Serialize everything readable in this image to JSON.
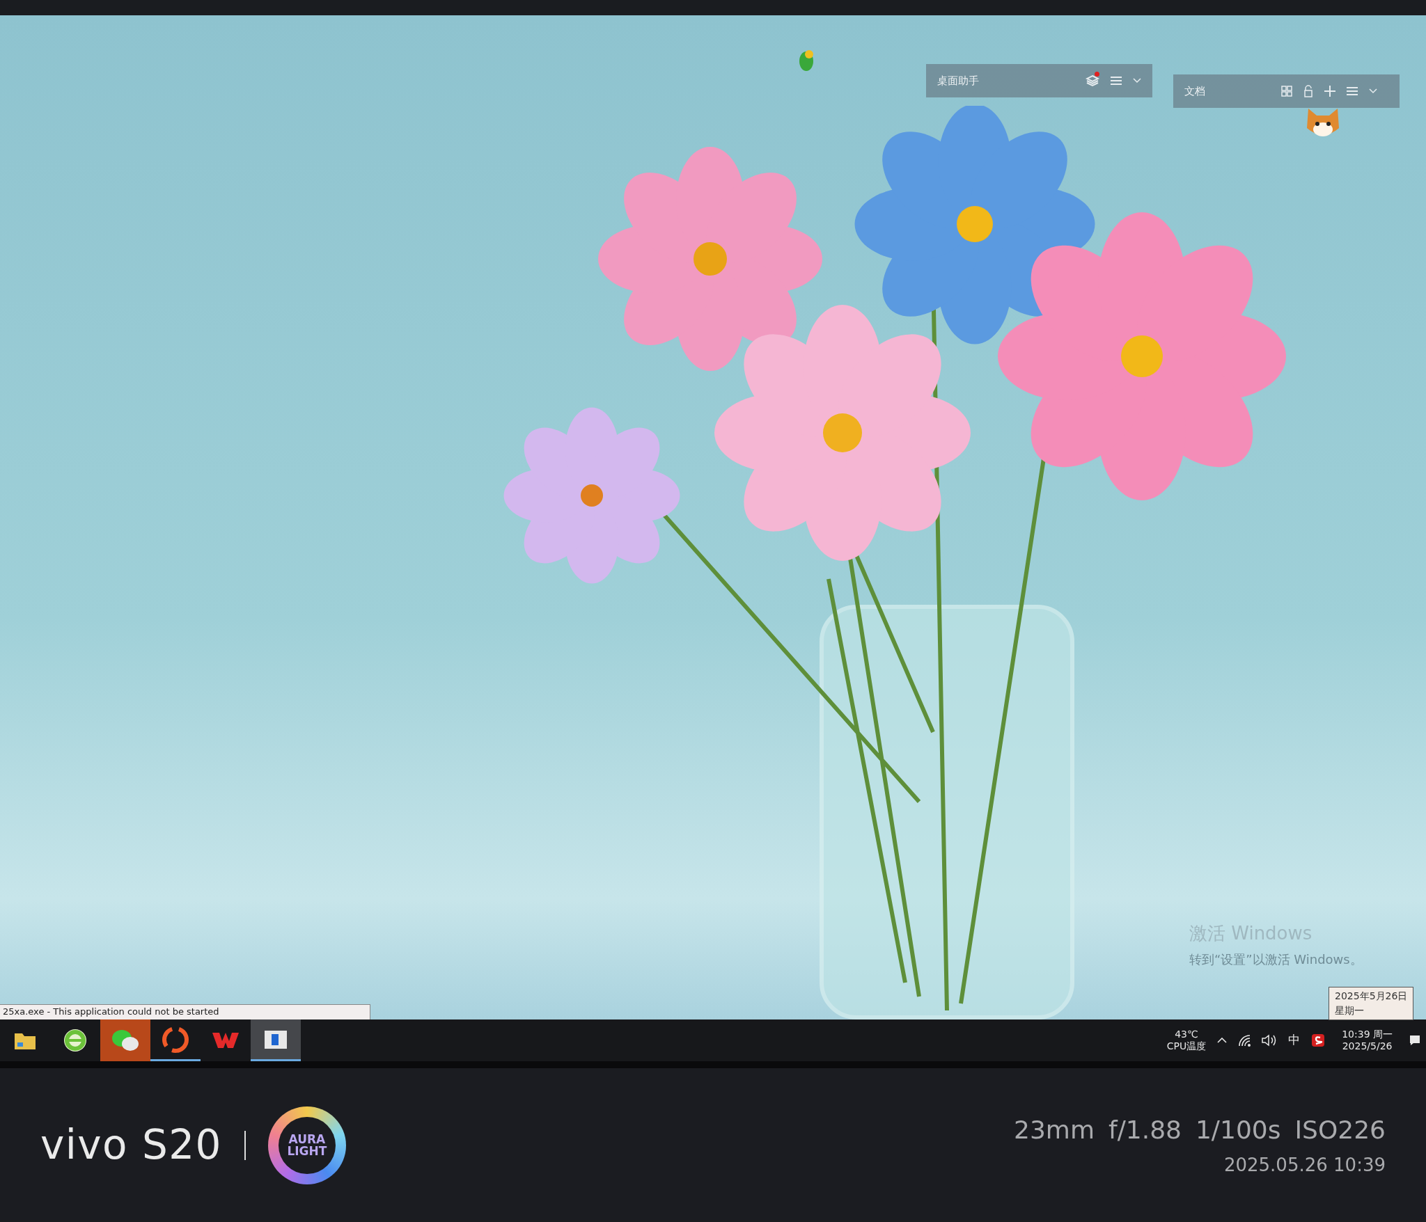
{
  "desktop": {
    "widgets": [
      {
        "kind": "assistant",
        "title": "桌面助手",
        "notification": true
      },
      {
        "kind": "docs",
        "title": "文档",
        "notification": false
      }
    ],
    "activation": {
      "title": "激活 Windows",
      "subtitle": "转到“设置”以激活 Windows。"
    },
    "date_tooltip": {
      "date": "2025年5月26日",
      "weekday": "星期一"
    },
    "error_bar": {
      "text": "25xa.exe - This application could not be started"
    }
  },
  "taskbar": {
    "apps": [
      {
        "kind": "folder",
        "running": false,
        "selected": false,
        "flashing": false
      },
      {
        "kind": "browser",
        "running": false,
        "selected": false,
        "flashing": false
      },
      {
        "kind": "chat",
        "running": false,
        "selected": false,
        "flashing": true
      },
      {
        "kind": "swirl",
        "running": true,
        "selected": false,
        "flashing": false
      },
      {
        "kind": "wps",
        "running": false,
        "selected": false,
        "flashing": false
      },
      {
        "kind": "window",
        "running": true,
        "selected": true,
        "flashing": false
      }
    ],
    "cpu": {
      "temperature": "43℃",
      "label": "CPU温度"
    },
    "ime": "中",
    "clock": {
      "time": "10:39 周一",
      "date": "2025/5/26"
    }
  },
  "camera_footer": {
    "brand": "vivo S20",
    "badge": [
      "AURA",
      "LIGHT"
    ],
    "settings": [
      "23mm",
      "f/1.88",
      "1/100s",
      "ISO226"
    ],
    "timestamp": "2025.05.26 10:39"
  }
}
